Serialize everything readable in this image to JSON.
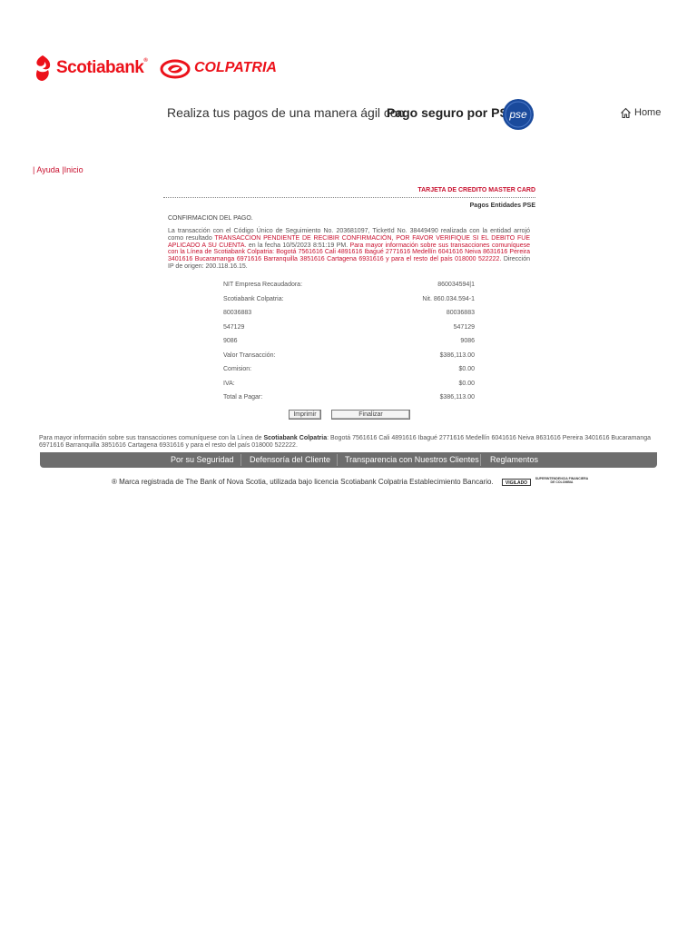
{
  "brand": {
    "name": "Scotiabank",
    "registered_mark": "®",
    "partner": "COLPATRIA",
    "color": "#ec111a"
  },
  "banner": {
    "text": "Realiza tus pagos de una manera ágil con",
    "bold_text": "Pago seguro por PSE",
    "logo_text": "pse",
    "logo_color": "#1a4a9c"
  },
  "home": {
    "label": "Home",
    "icon": "home-icon"
  },
  "breadcrumb": {
    "separator1": "|",
    "help": "Ayuda",
    "separator2": "|",
    "start": "Inicio"
  },
  "card": {
    "type": "TARJETA DE CREDITO MASTER CARD",
    "subtitle": "Pagos Entidades  PSE"
  },
  "confirmation": {
    "title": "CONFIRMACION DEL PAGO.",
    "msg_part1": "La transacción con el Código Único de Seguimiento No. 203681097, TicketId No. 38449490  realizada con la entidad  arrojó como resultado ",
    "msg_status": "TRANSACCION PENDIENTE DE RECIBIR CONFIRMACIÓN, POR FAVOR VERIFIQUE SI EL DEBITO FUE APLICADO A SU CUENTA.",
    "msg_part2": " en la fecha 10/5/2023 8:51:19 PM. ",
    "msg_contact": "Para mayor información sobre sus transacciones comuníquese con la Línea de Scotiabank Colpatria: Bogotá 7561616 Cali 4891616 Ibagué 2771616 Medellín 6041616 Neiva 8631616 Pereira 3401616 Bucaramanga 6971616 Barranquilla 3851616 Cartagena 6931616 y para el resto del país 018000 522222.",
    "msg_part3": " Dirección IP de origen: 200.118.16.15."
  },
  "details": {
    "rows": [
      {
        "label": "NIT Empresa Recaudadora:",
        "value": "860034594|1"
      },
      {
        "label": "Scotiabank Colpatria:",
        "value": "Nit. 860.034.594-1"
      },
      {
        "label": "80036883",
        "value": "80036883"
      },
      {
        "label": "547129",
        "value": "547129"
      },
      {
        "label": "9086",
        "value": "9086"
      },
      {
        "label": "Valor Transacción:",
        "value": "$386,113.00"
      },
      {
        "label": "Comision:",
        "value": "$0.00"
      },
      {
        "label": "IVA:",
        "value": "$0.00"
      },
      {
        "label": "Total a Pagar:",
        "value": "$386,113.00"
      }
    ]
  },
  "buttons": {
    "print": "Imprimir",
    "finish": "Finalizar"
  },
  "footer": {
    "info_part1": "Para mayor información sobre sus transacciones comuníquese con la Línea de ",
    "info_bold": "Scotiabank Colpatria",
    "info_part2": ": Bogotá 7561616 Cali 4891616 Ibagué 2771616 Medellín 6041616 Neiva 8631616 Pereira 3401616 Bucaramanga 6971616 Barranquilla 3851616 Cartagena 6931616 y para el resto del país 018000 522222.",
    "nav": [
      "Por su Seguridad",
      "Defensoría del Cliente",
      "Transparencia con Nuestros Clientes",
      "Reglamentos"
    ],
    "legal": "® Marca registrada de The Bank of Nova Scotia, utilizada bajo licencia Scotiabank Colpatria Establecimiento Bancario.",
    "vigilado": "VIGILADO",
    "superintendencia": "SUPERINTENDENCIA FINANCIERA DE COLOMBIA"
  }
}
